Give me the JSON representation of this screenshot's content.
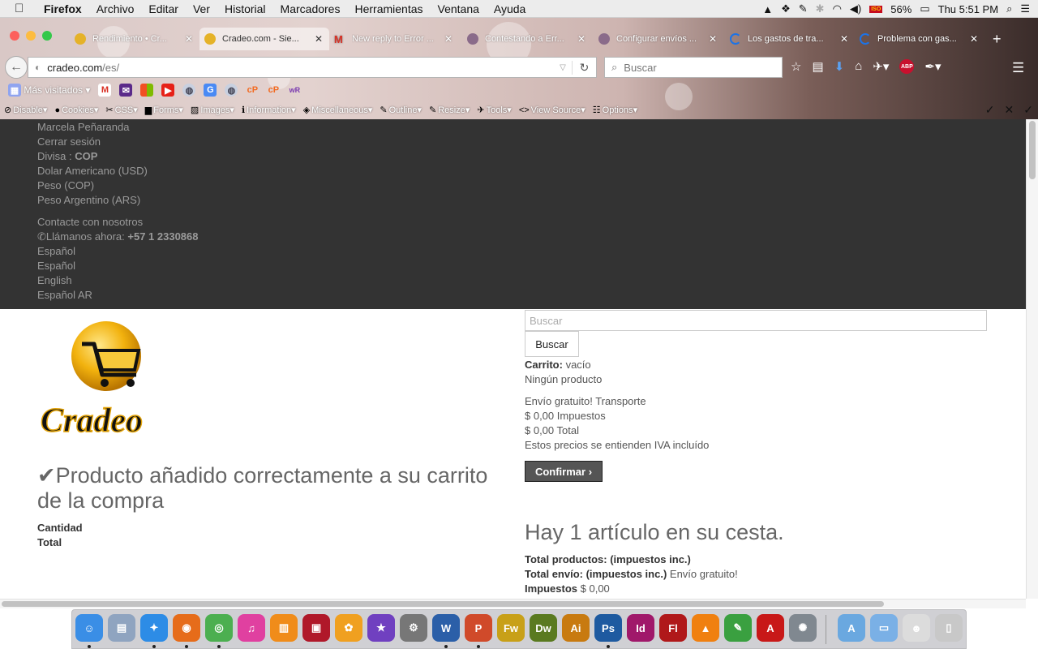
{
  "menubar": {
    "apple": "",
    "items": [
      "Firefox",
      "Archivo",
      "Editar",
      "Ver",
      "Historial",
      "Marcadores",
      "Herramientas",
      "Ventana",
      "Ayuda"
    ],
    "battery": "56%",
    "clock": "Thu 5:51 PM",
    "flag_label": "ISO"
  },
  "tabs": [
    {
      "title": "Rendimiento • Cr...",
      "color": "#e5b228"
    },
    {
      "title": "Cradeo.com - Sie...",
      "color": "#e5b228"
    },
    {
      "title": "New reply to Error ...",
      "color": "#d93025"
    },
    {
      "title": "Contestando a Err...",
      "color": "#8a6b8a"
    },
    {
      "title": "Configurar envíos ...",
      "color": "#8a6b8a"
    },
    {
      "title": "Los gastos de tra...",
      "color": "#1b73e8"
    },
    {
      "title": "Problema con gas...",
      "color": "#1b73e8"
    }
  ],
  "nav": {
    "url_host": "cradeo.com",
    "url_path": "/es/",
    "search_placeholder": "Buscar"
  },
  "bookmarks": {
    "most_visited": "Más visitados"
  },
  "devtools": [
    "Disable",
    "Cookies",
    "CSS",
    "Forms",
    "Images",
    "Information",
    "Miscellaneous",
    "Outline",
    "Resize",
    "Tools",
    "View Source",
    "Options"
  ],
  "topnav": {
    "user": "Marcela Peñaranda",
    "logout": "Cerrar sesión",
    "currency_label": "Divisa :",
    "currency_value": "COP",
    "cur1": "Dolar Americano (USD)",
    "cur2": "Peso (COP)",
    "cur3": "Peso Argentino (ARS)",
    "contact": "Contacte con nosotros",
    "call_label": "Llámanos ahora:",
    "call_number": "+57 1 2330868",
    "lang1": "Español",
    "lang2": "Español",
    "lang3": "English",
    "lang4": "Español AR"
  },
  "logo_text": "Cradeo",
  "search": {
    "placeholder": "Buscar",
    "button": "Buscar"
  },
  "cart": {
    "label": "Carrito:",
    "status": "vacío",
    "no_product": "Ningún producto",
    "shipping": "Envío gratuito! Transporte",
    "taxes": "$ 0,00 Impuestos",
    "total": "$ 0,00 Total",
    "vat_note": "Estos precios se entienden IVA incluído",
    "confirm": "Confirmar"
  },
  "success": {
    "message": "Producto añadido correctamente a su carrito de la compra",
    "quantity_label": "Cantidad",
    "total_label": "Total"
  },
  "summary": {
    "title": "Hay 1 artículo en su cesta.",
    "products_label": "Total productos: (impuestos inc.)",
    "shipping_label": "Total envío: (impuestos inc.)",
    "shipping_value": "Envío gratuito!",
    "taxes_label": "Impuestos",
    "taxes_value": "$ 0,00"
  },
  "dock": [
    {
      "name": "Finder",
      "glyph": "☺",
      "color": "#3a8ee6"
    },
    {
      "name": "Preview",
      "glyph": "▤",
      "color": "#8fa4c0"
    },
    {
      "name": "Safari",
      "glyph": "✦",
      "color": "#2d8ce6"
    },
    {
      "name": "Firefox",
      "glyph": "◉",
      "color": "#e66c1a"
    },
    {
      "name": "Chrome",
      "glyph": "◎",
      "color": "#4caf50"
    },
    {
      "name": "iTunes",
      "glyph": "♫",
      "color": "#e040a0"
    },
    {
      "name": "iBooks",
      "glyph": "▥",
      "color": "#f08c1a"
    },
    {
      "name": "Photo Booth",
      "glyph": "▣",
      "color": "#b0182a"
    },
    {
      "name": "Photos",
      "glyph": "✿",
      "color": "#f0a020"
    },
    {
      "name": "iMovie",
      "glyph": "★",
      "color": "#7040c0"
    },
    {
      "name": "System Preferences",
      "glyph": "⚙",
      "color": "#777777"
    },
    {
      "name": "Word",
      "glyph": "W",
      "color": "#2b5fa8"
    },
    {
      "name": "PowerPoint",
      "glyph": "P",
      "color": "#d04a2a"
    },
    {
      "name": "Fireworks",
      "glyph": "Fw",
      "color": "#c8a018"
    },
    {
      "name": "Dreamweaver",
      "glyph": "Dw",
      "color": "#5a7a20"
    },
    {
      "name": "Illustrator",
      "glyph": "Ai",
      "color": "#c87a10"
    },
    {
      "name": "Photoshop",
      "glyph": "Ps",
      "color": "#1e5aa0"
    },
    {
      "name": "InDesign",
      "glyph": "Id",
      "color": "#a0186a"
    },
    {
      "name": "Flash",
      "glyph": "Fl",
      "color": "#b0181a"
    },
    {
      "name": "VLC",
      "glyph": "▲",
      "color": "#f08010"
    },
    {
      "name": "Evernote",
      "glyph": "✎",
      "color": "#3aa040"
    },
    {
      "name": "Acrobat",
      "glyph": "A",
      "color": "#c81818"
    },
    {
      "name": "Utility",
      "glyph": "✺",
      "color": "#808890"
    },
    {
      "name": "Applications",
      "glyph": "A",
      "color": "#6aa8e0"
    },
    {
      "name": "Documents",
      "glyph": "▭",
      "color": "#7ab0e6"
    },
    {
      "name": "Downloads",
      "glyph": "☻",
      "color": "#dcdcdc"
    },
    {
      "name": "Trash",
      "glyph": "▯",
      "color": "#c8c8c8"
    }
  ]
}
